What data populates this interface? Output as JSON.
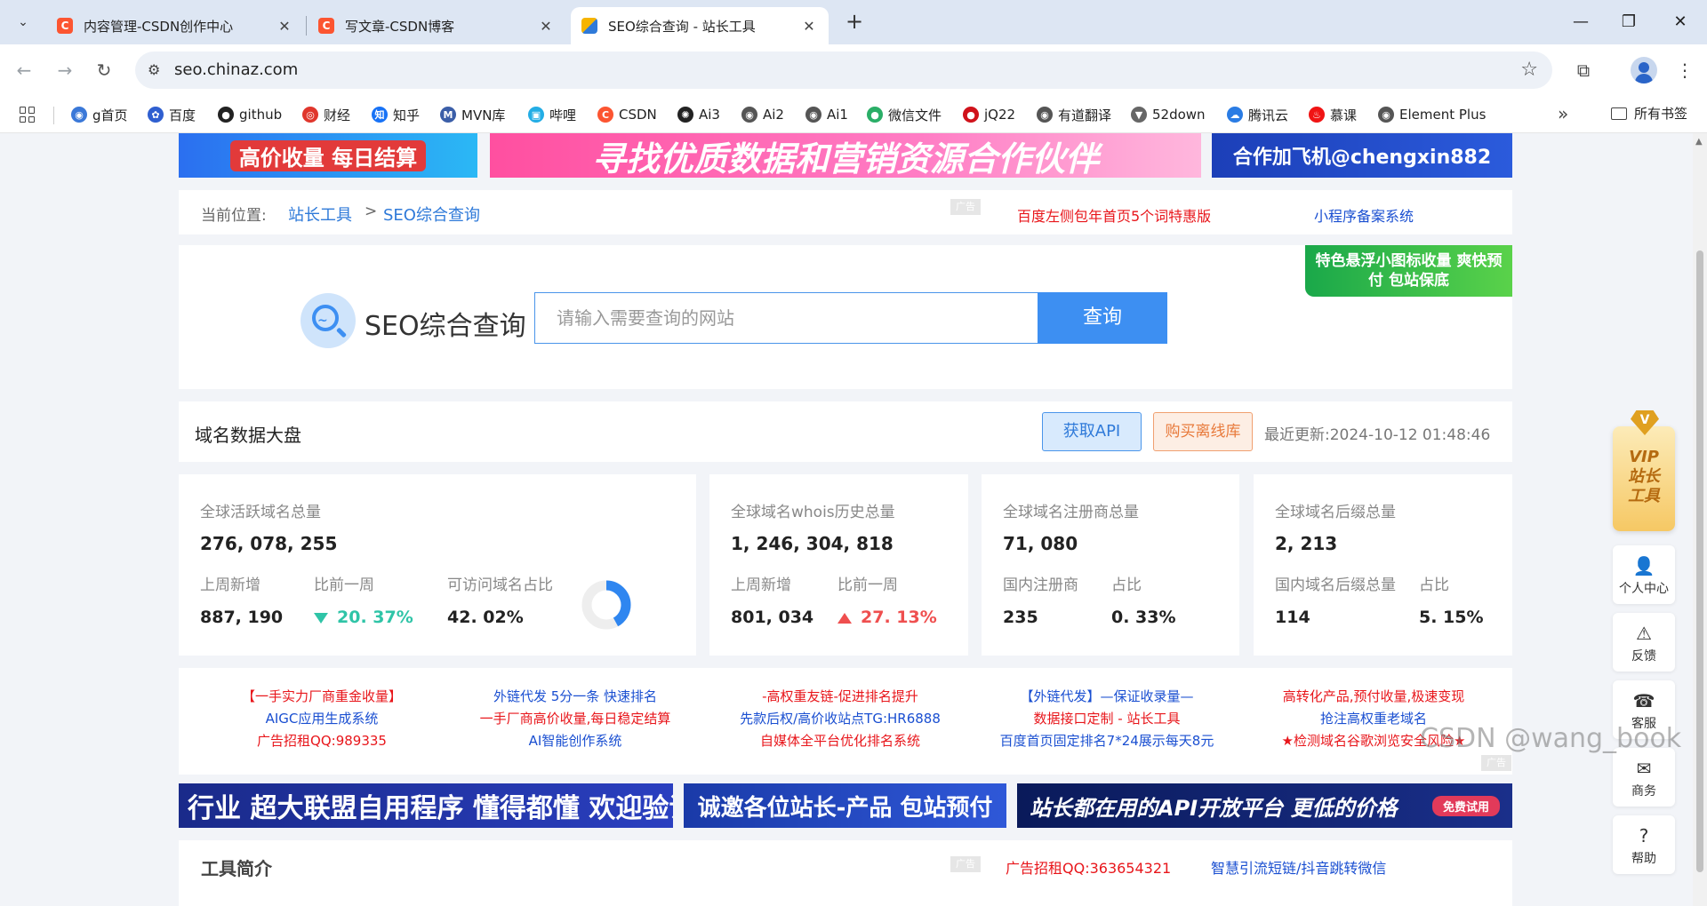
{
  "browser": {
    "tabs": [
      {
        "title": "内容管理-CSDN创作中心",
        "icon": "csdn-icon"
      },
      {
        "title": "写文章-CSDN博客",
        "icon": "csdn-icon"
      },
      {
        "title": "SEO综合查询 - 站长工具",
        "icon": "chinaz-icon"
      }
    ],
    "close_glyph": "✕",
    "new_tab": "+",
    "url": "seo.chinaz.com",
    "bookmarks": [
      {
        "label": "g首页",
        "icon": "globe-icon",
        "color": "#3a78d8"
      },
      {
        "label": "百度",
        "icon": "baidu-paw-icon",
        "color": "#2f5fd0"
      },
      {
        "label": "github",
        "icon": "github-icon",
        "color": "#222222"
      },
      {
        "label": "财经",
        "icon": "weibo-icon",
        "color": "#e0362c"
      },
      {
        "label": "知乎",
        "icon": "zhihu-icon",
        "color": "#1772f6"
      },
      {
        "label": "MVN库",
        "icon": "mvn-icon",
        "color": "#3b5ea8"
      },
      {
        "label": "哔哩",
        "icon": "bilibili-icon",
        "color": "#23ade5"
      },
      {
        "label": "CSDN",
        "icon": "csdn-icon",
        "color": "#fc5531"
      },
      {
        "label": "Ai3",
        "icon": "openai-icon",
        "color": "#222222"
      },
      {
        "label": "Ai2",
        "icon": "globe-icon",
        "color": "#555555"
      },
      {
        "label": "Ai1",
        "icon": "globe-icon",
        "color": "#555555"
      },
      {
        "label": "微信文件",
        "icon": "wechat-icon",
        "color": "#2aae67"
      },
      {
        "label": "jQ22",
        "icon": "jq22-icon",
        "color": "#d0121b"
      },
      {
        "label": "有道翻译",
        "icon": "globe-icon",
        "color": "#555555"
      },
      {
        "label": "52down",
        "icon": "download-icon",
        "color": "#666666"
      },
      {
        "label": "腾讯云",
        "icon": "cloud-icon",
        "color": "#2a7ce4"
      },
      {
        "label": "慕课",
        "icon": "fire-icon",
        "color": "#f01414"
      },
      {
        "label": "Element Plus",
        "icon": "globe-icon",
        "color": "#555555"
      }
    ],
    "bookmarks_more": "»",
    "all_bookmarks": "所有书签"
  },
  "banners": {
    "top_left": "高价收量  每日结算",
    "top_middle": "寻找优质数据和营销资源合作伙伴",
    "top_right": "合作加飞机@chengxin882",
    "vip_float": "特色悬浮小图标收量 爽快预付 包站保底",
    "bottom_1": "行业 超大联盟自用程序 懂得都懂 欢迎验证",
    "bottom_2": "诚邀各位站长-产品 包站预付",
    "bottom_3": "站长都在用的API开放平台 更低的价格",
    "bottom_3_tag": "免费试用"
  },
  "breadcrumb": {
    "label": "当前位置:",
    "home": "站长工具",
    "sep": ">",
    "current": "SEO综合查询"
  },
  "ad_tag": "广告",
  "header_ads": {
    "red": "百度左侧包年首页5个词特惠版",
    "blue": "小程序备案系统"
  },
  "search": {
    "title": "SEO综合查询",
    "placeholder": "请输入需要查询的网站",
    "button": "查询"
  },
  "domain_panel": {
    "title": "域名数据大盘",
    "api_button": "获取API",
    "buy_button": "购买离线库",
    "updated": "最近更新:2024-10-12 01:48:46"
  },
  "stats": {
    "active": {
      "label": "全球活跃域名总量",
      "total": "276, 078, 255",
      "weekly_label": "上周新增",
      "weekly": "887, 190",
      "change_label": "比前一周",
      "change": "20. 37%",
      "ratio_label": "可访问域名占比",
      "ratio": "42. 02%",
      "ratio_fraction": 0.4202
    },
    "whois": {
      "label": "全球域名whois历史总量",
      "total": "1, 246, 304, 818",
      "weekly_label": "上周新增",
      "weekly": "801, 034",
      "change_label": "比前一周",
      "change": "27. 13%"
    },
    "registrar": {
      "label": "全球域名注册商总量",
      "total": "71, 080",
      "sub_label": "国内注册商",
      "sub": "235",
      "ratio_label": "占比",
      "ratio": "0. 33%"
    },
    "suffix": {
      "label": "全球域名后缀总量",
      "total": "2, 213",
      "sub_label": "国内域名后缀总量",
      "sub": "114",
      "ratio_label": "占比",
      "ratio": "5. 15%"
    }
  },
  "text_ads": [
    {
      "lines": [
        {
          "text": "【一手实力厂商重金收量】",
          "color": "#e8161b"
        },
        {
          "text": "AIGC应用生成系统",
          "color": "#1a4fd1"
        },
        {
          "text": "广告招租QQ:989335",
          "color": "#e8161b"
        }
      ]
    },
    {
      "lines": [
        {
          "text": "外链代发 5分一条 快速排名",
          "color": "#1a4fd1"
        },
        {
          "text": "一手厂商高价收量,每日稳定结算",
          "color": "#e8161b"
        },
        {
          "text": "AI智能创作系统",
          "color": "#1a4fd1"
        }
      ]
    },
    {
      "lines": [
        {
          "text": "-高权重友链-促进排名提升",
          "color": "#e8161b"
        },
        {
          "text": "先款后权/高价收站点TG:HR6888",
          "color": "#1a4fd1"
        },
        {
          "text": "自媒体全平台优化排名系统",
          "color": "#e8161b"
        }
      ]
    },
    {
      "lines": [
        {
          "text": "【外链代发】—保证收录量—",
          "color": "#1a4fd1"
        },
        {
          "text": "数据接口定制 - 站长工具",
          "color": "#e8161b"
        },
        {
          "text": "百度首页固定排名7*24展示每天8元",
          "color": "#1a4fd1"
        }
      ]
    },
    {
      "lines": [
        {
          "text": "高转化产品,预付收量,极速变现",
          "color": "#e8161b"
        },
        {
          "text": "抢注高权重老域名",
          "color": "#1a4fd1"
        },
        {
          "text": "★检测域名谷歌浏览安全风险★",
          "color": "#e8161b"
        }
      ]
    }
  ],
  "tools_intro": {
    "title": "工具简介",
    "ad_red": "广告招租QQ:363654321",
    "ad_blue": "智慧引流短链/抖音跳转微信"
  },
  "side_float": {
    "vip": "VIP 站长 工具",
    "vip_gem": "V",
    "items": [
      {
        "label": "个人中心",
        "icon": "user-icon",
        "glyph": "👤"
      },
      {
        "label": "反馈",
        "icon": "feedback-icon",
        "glyph": "⚠"
      },
      {
        "label": "客服",
        "icon": "headset-icon",
        "glyph": "☎"
      },
      {
        "label": "商务",
        "icon": "handshake-icon",
        "glyph": "✉"
      },
      {
        "label": "帮助",
        "icon": "help-icon",
        "glyph": "?"
      }
    ],
    "collapse": "^"
  },
  "watermark": "CSDN @wang_book"
}
